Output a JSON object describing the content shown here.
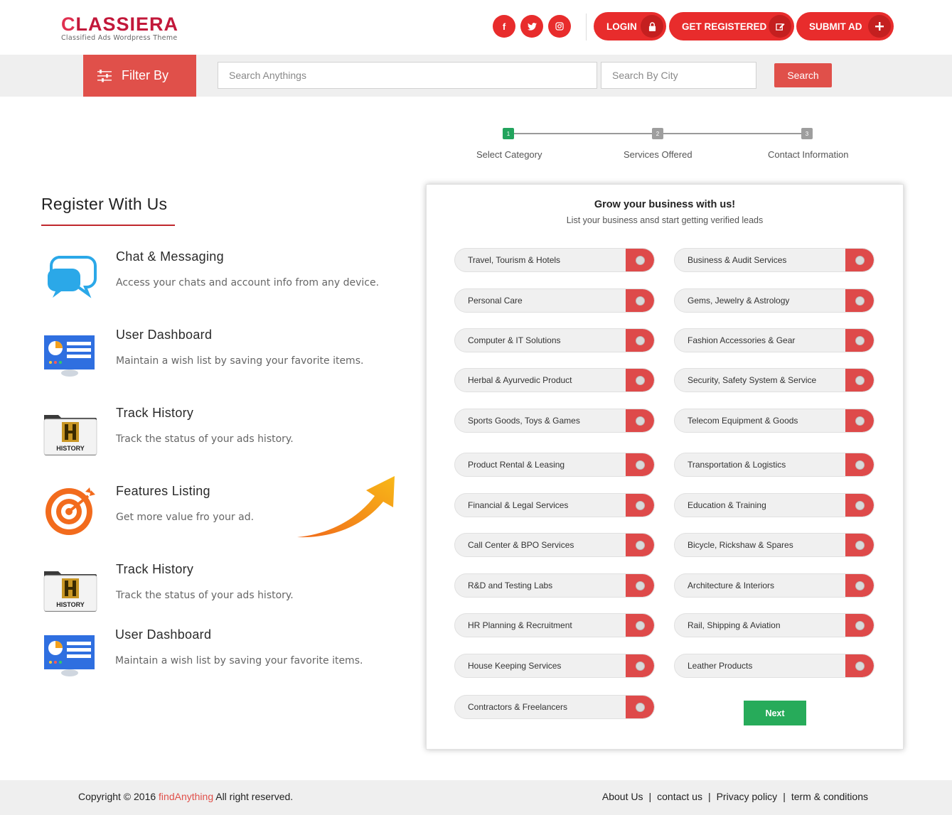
{
  "brand": {
    "logo_main": "LASSIERA",
    "logo_first": "C",
    "logo_sub": "Classified Ads Wordpress Theme"
  },
  "social": [
    {
      "icon": "facebook-icon",
      "glyph": "f"
    },
    {
      "icon": "twitter-icon",
      "glyph": "t"
    },
    {
      "icon": "instagram-icon",
      "glyph": "◎"
    }
  ],
  "header_buttons": {
    "login": "LOGIN",
    "register": "GET REGISTERED",
    "submit_ad": "SUBMIT AD"
  },
  "search": {
    "filter_label": "Filter By",
    "keyword_placeholder": "Search Anythings",
    "city_placeholder": "Search By City",
    "button": "Search"
  },
  "steps": [
    {
      "num": "1",
      "label": "Select Category",
      "active": true
    },
    {
      "num": "2",
      "label": "Services Offered",
      "active": false
    },
    {
      "num": "3",
      "label": "Contact Information",
      "active": false
    }
  ],
  "register": {
    "title": "Register With Us",
    "features": [
      {
        "title": "Chat & Messaging",
        "desc": "Access your chats and account info from any device.",
        "icon": "chat-bubbles-icon"
      },
      {
        "title": "User Dashboard",
        "desc": "Maintain a wish list by saving your favorite items.",
        "icon": "dashboard-icon"
      },
      {
        "title": "Track History",
        "desc": "Track the status of your ads history.",
        "icon": "history-folder-icon"
      },
      {
        "title": "Features Listing",
        "desc": "Get more value fro your ad.",
        "icon": "target-icon"
      },
      {
        "title": "Track History",
        "desc": "Track the status of your ads history.",
        "icon": "history-folder-icon"
      },
      {
        "title": "User Dashboard",
        "desc": "Maintain a wish list by saving your favorite items.",
        "icon": "dashboard-icon"
      }
    ]
  },
  "card": {
    "title": "Grow your business with us!",
    "subtitle": "List your business ansd start getting verified leads",
    "categories_left": [
      "Travel, Tourism & Hotels",
      "Personal Care",
      "Computer & IT Solutions",
      "Herbal & Ayurvedic Product",
      "Sports Goods, Toys & Games",
      "Product Rental & Leasing",
      "Financial & Legal Services",
      "Call Center & BPO Services",
      "R&D and Testing Labs",
      "HR Planning & Recruitment",
      "House Keeping Services",
      "Contractors & Freelancers"
    ],
    "categories_right": [
      "Business & Audit Services",
      "Gems, Jewelry & Astrology",
      "Fashion Accessories & Gear",
      "Security, Safety System & Service",
      "Telecom Equipment & Goods",
      "Transportation & Logistics",
      "Education & Training",
      "Bicycle, Rickshaw & Spares",
      "Architecture & Interiors",
      "Rail, Shipping & Aviation",
      "Leather Products"
    ],
    "next": "Next"
  },
  "footer": {
    "copy_prefix": "Copyright © 2016",
    "copy_brand": "findAnything",
    "copy_suffix": "All right reserved.",
    "links": [
      "About Us",
      "contact us",
      "Privacy policy",
      "term & conditions"
    ],
    "separator": "|"
  },
  "colors": {
    "accent": "#e82c2c",
    "filter": "#e0504a",
    "green": "#22a45d"
  }
}
